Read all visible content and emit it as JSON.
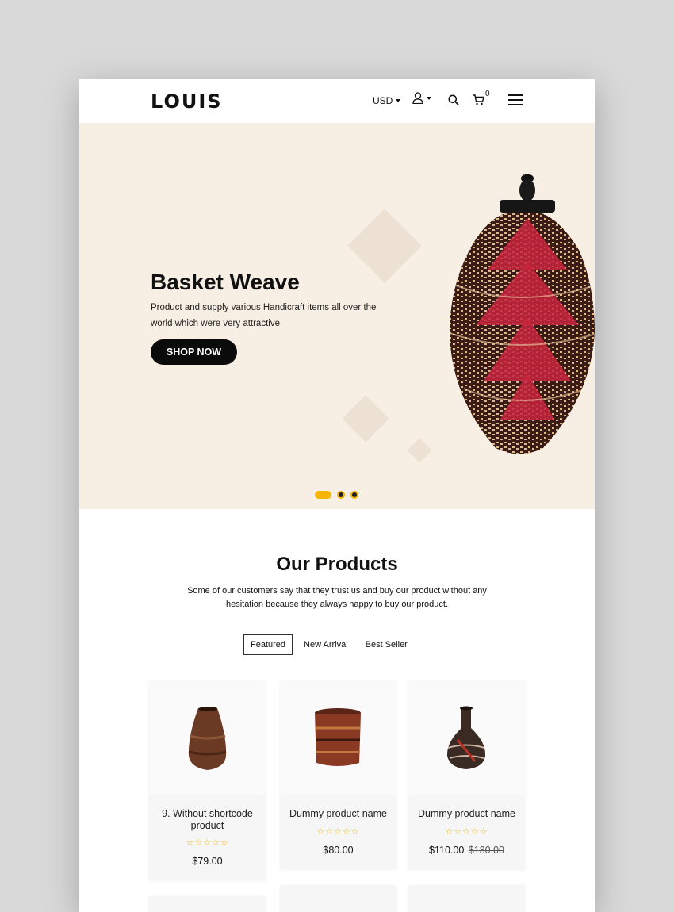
{
  "header": {
    "logo": "LOUIS",
    "currency": "USD",
    "cart_count": "0",
    "icons": [
      "user-icon",
      "search-icon",
      "cart-icon",
      "menu-icon"
    ]
  },
  "hero": {
    "title": "Basket Weave",
    "text": "Product and supply various Handicraft items all over the world which were very attractive",
    "cta": "SHOP NOW",
    "slides": {
      "count": 3,
      "active": 1
    }
  },
  "products": {
    "title": "Our Products",
    "description": "Some of our customers say that they trust us and buy our product without any hesitation because they always happy to buy our product.",
    "tabs": [
      {
        "label": "Featured"
      },
      {
        "label": "New Arrival"
      },
      {
        "label": "Best Seller"
      }
    ],
    "items": [
      {
        "name": "9. Without shortcode product",
        "price": "$79.00",
        "old_price": "",
        "rating": 0
      },
      {
        "name": "Dummy product name",
        "price": "$80.00",
        "old_price": "",
        "rating": 0
      },
      {
        "name": "Dummy product name",
        "price": "$110.00",
        "old_price": "$130.00",
        "rating": 0
      }
    ]
  },
  "colors": {
    "accent": "#f5b400",
    "hero_bg": "#f7efe3",
    "button": "#0b0b0b",
    "stars": "#f0b000"
  }
}
